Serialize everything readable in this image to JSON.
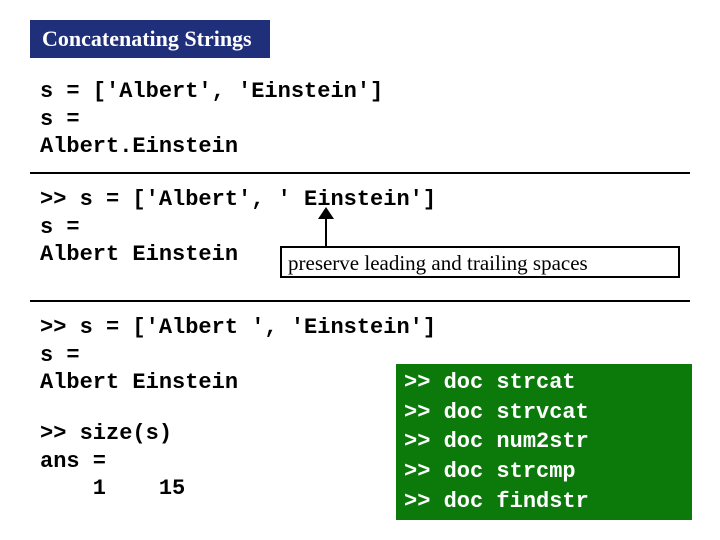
{
  "title": "Concatenating Strings",
  "block1": "s = ['Albert', 'Einstein']\ns =\nAlbert.Einstein",
  "block2": ">> s = ['Albert', ' Einstein']\ns =\nAlbert Einstein",
  "annotation": "preserve leading and trailing spaces",
  "block3": ">> s = ['Albert ', 'Einstein']\ns =\nAlbert Einstein",
  "block4": ">> size(s)\nans =\n    1    15",
  "docbox": ">> doc strcat\n>> doc strvcat\n>> doc num2str\n>> doc strcmp\n>> doc findstr"
}
